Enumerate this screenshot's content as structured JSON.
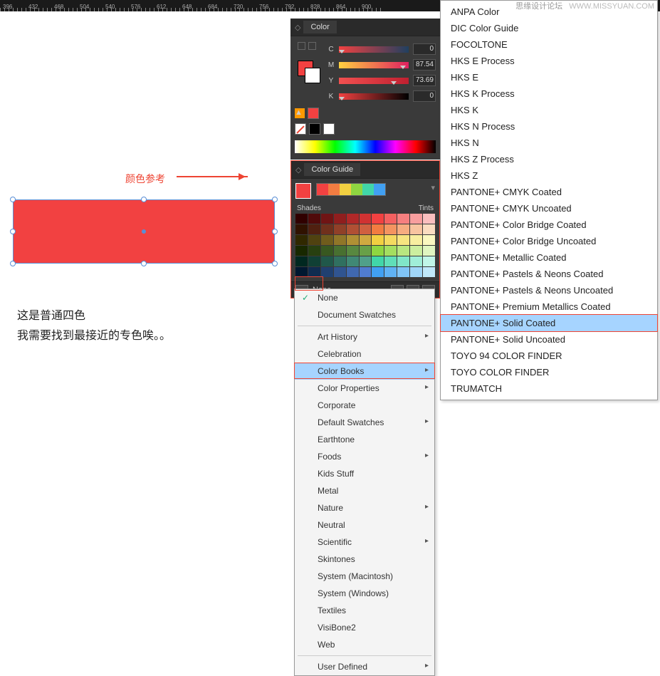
{
  "ruler_marks": [
    396,
    432,
    468,
    504,
    540,
    576,
    612,
    648,
    684,
    720,
    756,
    792,
    828,
    864,
    900
  ],
  "watermark": {
    "site": "思缘设计论坛",
    "url": "WWW.MISSYUAN.COM"
  },
  "canvas": {
    "color_guide_label": "颜色参考",
    "body_line1": "这是普通四色",
    "body_line2": "我需要找到最接近的专色唉。。"
  },
  "color_panel": {
    "title": "Color",
    "cmyk": [
      {
        "label": "C",
        "value": "0",
        "gradient": "linear-gradient(to right,#f24141,#204060)",
        "pos": 0
      },
      {
        "label": "M",
        "value": "87.54",
        "gradient": "linear-gradient(to right,#ffd040,#e02060)",
        "pos": 88
      },
      {
        "label": "Y",
        "value": "73.69",
        "gradient": "linear-gradient(to right,#f25050,#c02030)",
        "pos": 74
      },
      {
        "label": "K",
        "value": "0",
        "gradient": "linear-gradient(to right,#f24141,#000)",
        "pos": 0
      }
    ]
  },
  "guide_panel": {
    "title": "Color Guide",
    "shades_label": "Shades",
    "tints_label": "Tints",
    "footer_label": "None",
    "harmony_colors": [
      "#f24141",
      "#f27c41",
      "#f2d041",
      "#8fd641",
      "#41d6a8",
      "#41a0f2"
    ],
    "grid_rows": [
      [
        "#300000",
        "#500a0a",
        "#701414",
        "#901e1e",
        "#b02828",
        "#d03232",
        "#f24141",
        "#f46060",
        "#f67f7f",
        "#f89e9e",
        "#fabebe"
      ],
      [
        "#301200",
        "#502010",
        "#70301c",
        "#904028",
        "#b05034",
        "#d06040",
        "#f27c41",
        "#f49460",
        "#f6ac80",
        "#f8c4a0",
        "#fadcc0"
      ],
      [
        "#302800",
        "#504210",
        "#705c1c",
        "#907628",
        "#b09034",
        "#d0aa40",
        "#f2d041",
        "#f4da60",
        "#f6e480",
        "#f8eea0",
        "#faf8c0"
      ],
      [
        "#182800",
        "#284010",
        "#385820",
        "#487030",
        "#588840",
        "#68a048",
        "#8fd641",
        "#a4de60",
        "#b8e680",
        "#ccee9f",
        "#e0f6c0"
      ],
      [
        "#002820",
        "#104035",
        "#20584a",
        "#307060",
        "#408875",
        "#50a08a",
        "#41d6a8",
        "#60deb8",
        "#80e6c8",
        "#a0eed8",
        "#c0f6e8"
      ],
      [
        "#001830",
        "#102c50",
        "#204070",
        "#305490",
        "#4068b0",
        "#507cd0",
        "#41a0f2",
        "#60b2f4",
        "#80c4f6",
        "#a0d6f8",
        "#c0e8fa"
      ]
    ]
  },
  "menu1": {
    "items_top": [
      "None",
      "Document Swatches"
    ],
    "items_mid": [
      {
        "label": "Art History",
        "sub": true
      },
      {
        "label": "Celebration",
        "sub": false
      },
      {
        "label": "Color Books",
        "sub": true,
        "hl": true
      },
      {
        "label": "Color Properties",
        "sub": true
      },
      {
        "label": "Corporate",
        "sub": false
      },
      {
        "label": "Default Swatches",
        "sub": true
      },
      {
        "label": "Earthtone",
        "sub": false
      },
      {
        "label": "Foods",
        "sub": true
      },
      {
        "label": "Kids Stuff",
        "sub": false
      },
      {
        "label": "Metal",
        "sub": false
      },
      {
        "label": "Nature",
        "sub": true
      },
      {
        "label": "Neutral",
        "sub": false
      },
      {
        "label": "Scientific",
        "sub": true
      },
      {
        "label": "Skintones",
        "sub": false
      },
      {
        "label": "System (Macintosh)",
        "sub": false
      },
      {
        "label": "System (Windows)",
        "sub": false
      },
      {
        "label": "Textiles",
        "sub": false
      },
      {
        "label": "VisiBone2",
        "sub": false
      },
      {
        "label": "Web",
        "sub": false
      }
    ],
    "items_bot": [
      {
        "label": "User Defined",
        "sub": true
      }
    ]
  },
  "menu2": {
    "items": [
      "ANPA Color",
      "DIC Color Guide",
      "FOCOLTONE",
      "HKS E Process",
      "HKS E",
      "HKS K Process",
      "HKS K",
      "HKS N Process",
      "HKS N",
      "HKS Z Process",
      "HKS Z",
      "PANTONE+ CMYK Coated",
      "PANTONE+ CMYK Uncoated",
      "PANTONE+ Color Bridge Coated",
      "PANTONE+ Color Bridge Uncoated",
      "PANTONE+ Metallic Coated",
      "PANTONE+ Pastels & Neons Coated",
      "PANTONE+ Pastels & Neons Uncoated",
      "PANTONE+ Premium Metallics Coated",
      "PANTONE+ Solid Coated",
      "PANTONE+ Solid Uncoated",
      "TOYO 94 COLOR FINDER",
      "TOYO COLOR FINDER",
      "TRUMATCH"
    ],
    "highlight_index": 19
  }
}
